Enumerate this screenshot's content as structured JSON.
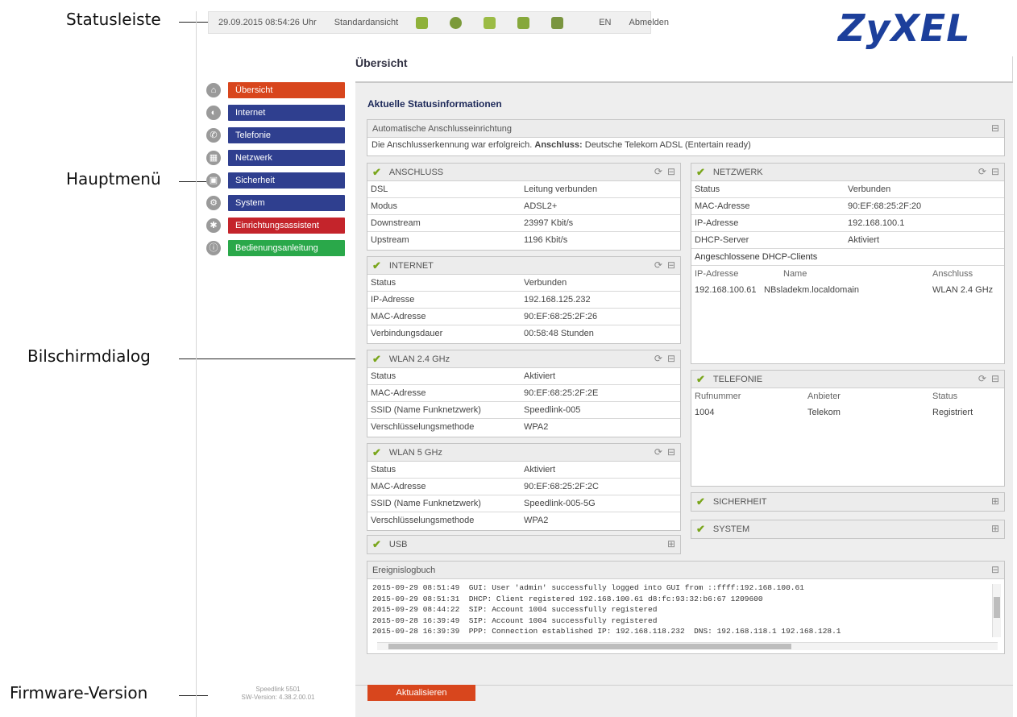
{
  "callouts": {
    "statusleiste": "Statusleiste",
    "hauptmenue": "Hauptmenü",
    "bildschirmdialog": "Bilschirmdialog",
    "firmware": "Firmware-Version"
  },
  "statusbar": {
    "datetime": "29.09.2015 08:54:26 Uhr",
    "view": "Standardansicht",
    "language": "EN",
    "logout": "Abmelden",
    "icons": [
      "dsl-icon",
      "internet-icon",
      "telephone-icon",
      "wlan-icon",
      "network-icon"
    ]
  },
  "logo": "ZyXEL",
  "page_title": "Übersicht",
  "nav": {
    "items": [
      {
        "label": "Übersicht",
        "color": "#d8461d",
        "icon": "home-icon"
      },
      {
        "label": "Internet",
        "color": "#2f3f8f",
        "icon": "globe-icon"
      },
      {
        "label": "Telefonie",
        "color": "#2f3f8f",
        "icon": "phone-icon"
      },
      {
        "label": "Netzwerk",
        "color": "#2f3f8f",
        "icon": "network-icon"
      },
      {
        "label": "Sicherheit",
        "color": "#2f3f8f",
        "icon": "lock-icon"
      },
      {
        "label": "System",
        "color": "#2f3f8f",
        "icon": "gear-icon"
      },
      {
        "label": "Einrichtungsassistent",
        "color": "#c4242b",
        "icon": "wizard-icon"
      },
      {
        "label": "Bedienungsanleitung",
        "color": "#2aa84a",
        "icon": "info-icon"
      }
    ]
  },
  "section_title": "Aktuelle Statusinformationen",
  "auto_connect": {
    "title": "Automatische Anschlusseinrichtung",
    "text_pre": "Die Anschlusserkennung war erfolgreich.",
    "text_bold": "Anschluss:",
    "text_post": "Deutsche Telekom ADSL (Entertain ready)"
  },
  "anschluss": {
    "title": "ANSCHLUSS",
    "rows": [
      {
        "label": "DSL",
        "value": "Leitung verbunden"
      },
      {
        "label": "Modus",
        "value": "ADSL2+"
      },
      {
        "label": "Downstream",
        "value": "23997 Kbit/s"
      },
      {
        "label": "Upstream",
        "value": "1196 Kbit/s"
      }
    ]
  },
  "internet": {
    "title": "INTERNET",
    "rows": [
      {
        "label": "Status",
        "value": "Verbunden"
      },
      {
        "label": "IP-Adresse",
        "value": "192.168.125.232"
      },
      {
        "label": "MAC-Adresse",
        "value": "90:EF:68:25:2F:26"
      },
      {
        "label": "Verbindungsdauer",
        "value": "00:58:48 Stunden"
      }
    ]
  },
  "wlan24": {
    "title": "WLAN 2.4 GHz",
    "rows": [
      {
        "label": "Status",
        "value": "Aktiviert"
      },
      {
        "label": "MAC-Adresse",
        "value": "90:EF:68:25:2F:2E"
      },
      {
        "label": "SSID (Name Funknetzwerk)",
        "value": "Speedlink-005"
      },
      {
        "label": "Verschlüsselungsmethode",
        "value": "WPA2"
      }
    ]
  },
  "wlan5": {
    "title": "WLAN 5 GHz",
    "rows": [
      {
        "label": "Status",
        "value": "Aktiviert"
      },
      {
        "label": "MAC-Adresse",
        "value": "90:EF:68:25:2F:2C"
      },
      {
        "label": "SSID (Name Funknetzwerk)",
        "value": "Speedlink-005-5G"
      },
      {
        "label": "Verschlüsselungsmethode",
        "value": "WPA2"
      }
    ]
  },
  "usb": {
    "title": "USB"
  },
  "netzwerk": {
    "title": "NETZWERK",
    "rows": [
      {
        "label": "Status",
        "value": "Verbunden"
      },
      {
        "label": "MAC-Adresse",
        "value": "90:EF:68:25:2F:20"
      },
      {
        "label": "IP-Adresse",
        "value": "192.168.100.1"
      },
      {
        "label": "DHCP-Server",
        "value": "Aktiviert"
      }
    ],
    "clients_title": "Angeschlossene DHCP-Clients",
    "clients_headers": [
      "IP-Adresse",
      "Name",
      "Anschluss"
    ],
    "clients": [
      {
        "ip": "192.168.100.61",
        "name": "NBsladekm.localdomain",
        "conn": "WLAN 2.4 GHz"
      }
    ]
  },
  "telefonie": {
    "title": "TELEFONIE",
    "headers": [
      "Rufnummer",
      "Anbieter",
      "Status"
    ],
    "rows": [
      {
        "number": "1004",
        "provider": "Telekom",
        "status": "Registriert"
      }
    ]
  },
  "sicherheit": {
    "title": "SICHERHEIT"
  },
  "system": {
    "title": "SYSTEM"
  },
  "log": {
    "title": "Ereignislogbuch",
    "lines": [
      "2015-09-29 08:51:49  GUI: User 'admin' successfully logged into GUI from ::ffff:192.168.100.61",
      "2015-09-29 08:51:31  DHCP: Client registered 192.168.100.61 d8:fc:93:32:b6:67 1209600",
      "2015-09-29 08:44:22  SIP: Account 1004 successfully registered",
      "2015-09-28 16:39:49  SIP: Account 1004 successfully registered",
      "2015-09-28 16:39:39  PPP: Connection established IP: 192.168.118.232  DNS: 192.168.118.1 192.168.128.1"
    ]
  },
  "update_button": "Aktualisieren",
  "firmware": {
    "model": "Speedlink 5501",
    "version": "SW-Version: 4.38.2.00.01"
  }
}
